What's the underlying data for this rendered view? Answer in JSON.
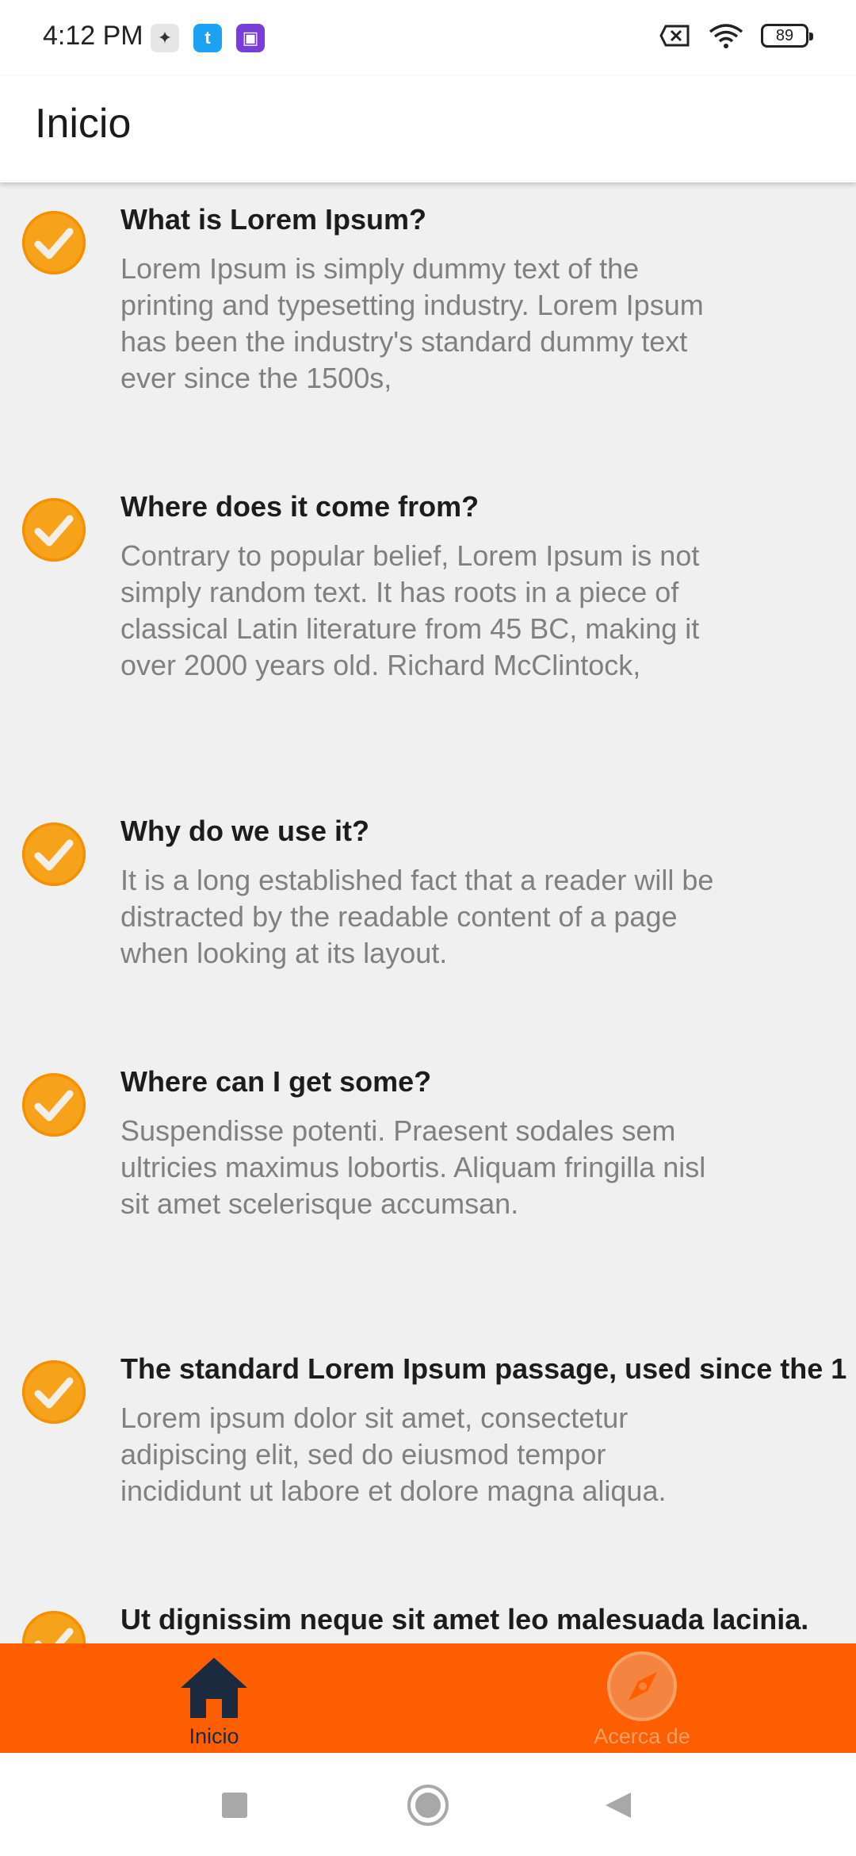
{
  "status_bar": {
    "time": "4:12 PM",
    "battery": "89",
    "app_icons": [
      "accessibility-icon",
      "twitter-icon",
      "twitch-icon"
    ]
  },
  "app_bar": {
    "title": "Inicio"
  },
  "items": [
    {
      "title": "What is Lorem Ipsum?",
      "body": "Lorem Ipsum is simply dummy text of the printing and typesetting industry. Lorem Ipsum has been the industry's standard dummy text ever since the 1500s,"
    },
    {
      "title": "Where does it come from?",
      "body": "Contrary to popular belief, Lorem Ipsum is not simply random text. It has roots in a piece of classical Latin literature from 45 BC, making it over 2000 years old. Richard McClintock,"
    },
    {
      "title": "Why do we use it?",
      "body": "It is a long established fact that a reader will be distracted by the readable content of a page when looking at its layout."
    },
    {
      "title": "Where can I get some?",
      "body": "Suspendisse potenti. Praesent sodales sem ultricies maximus lobortis. Aliquam fringilla nisl sit amet scelerisque accumsan."
    },
    {
      "title": "The standard Lorem Ipsum passage, used since the 1",
      "body": "Lorem ipsum dolor sit amet, consectetur adipiscing elit, sed do eiusmod tempor incididunt ut labore et dolore magna aliqua."
    },
    {
      "title": "Ut dignissim neque sit amet leo malesuada lacinia.",
      "body": ""
    }
  ],
  "bottom_nav": {
    "home_label": "Inicio",
    "about_label": "Acerca de"
  },
  "colors": {
    "accent": "#fd5f00",
    "check": "#f7a21b",
    "active_nav": "#1b2a3f"
  }
}
